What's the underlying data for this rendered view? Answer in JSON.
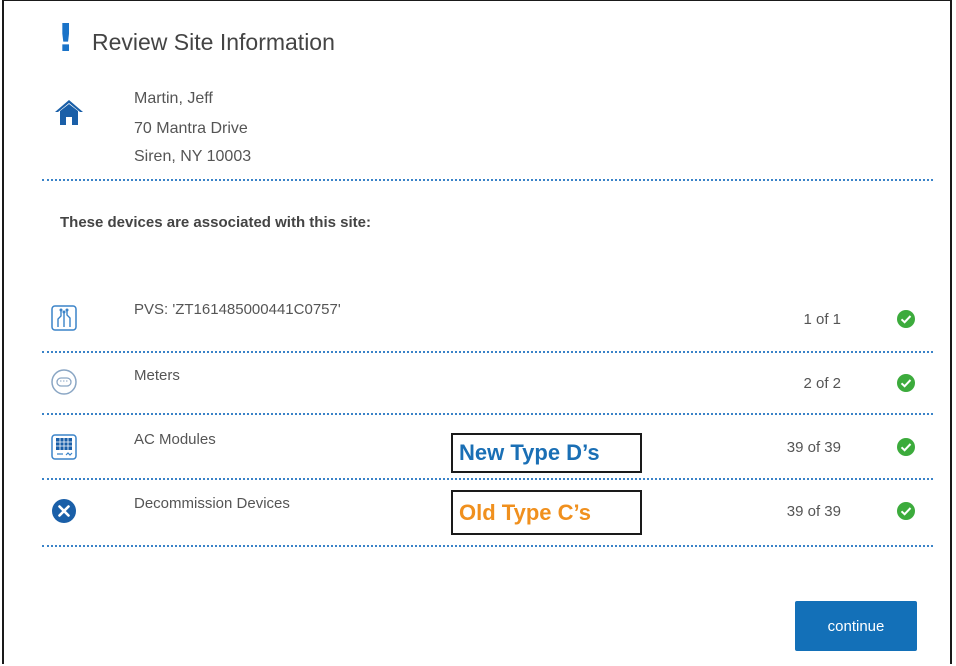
{
  "header": {
    "alert_glyph": "!",
    "title": "Review Site Information"
  },
  "site": {
    "icon": "house-icon",
    "name": "Martin, Jeff",
    "street": "70 Mantra Drive",
    "city_line": "Siren, NY 10003"
  },
  "devices_heading": "These devices are associated with this site:",
  "devices": [
    {
      "icon": "pvs-circuit-icon",
      "label": "PVS: 'ZT161485000441C0757'",
      "count": "1 of 1",
      "status": "check-circle-icon"
    },
    {
      "icon": "meter-icon",
      "label": "Meters",
      "count": "2 of 2",
      "status": "check-circle-icon"
    },
    {
      "icon": "solar-panel-icon",
      "label": "AC Modules",
      "count": "39 of 39",
      "status": "check-circle-icon"
    },
    {
      "icon": "x-circle-icon",
      "label": "Decommission Devices",
      "count": "39 of 39",
      "status": "check-circle-icon"
    }
  ],
  "annotations": {
    "new_type": {
      "text": "New Type D’s",
      "color": "#1a6fb5"
    },
    "old_type": {
      "text": "Old Type C’s",
      "color": "#f0901e"
    }
  },
  "continue_label": "continue",
  "colors": {
    "accent": "#1a73c8",
    "button": "#1370b8",
    "success": "#3cab3c"
  }
}
